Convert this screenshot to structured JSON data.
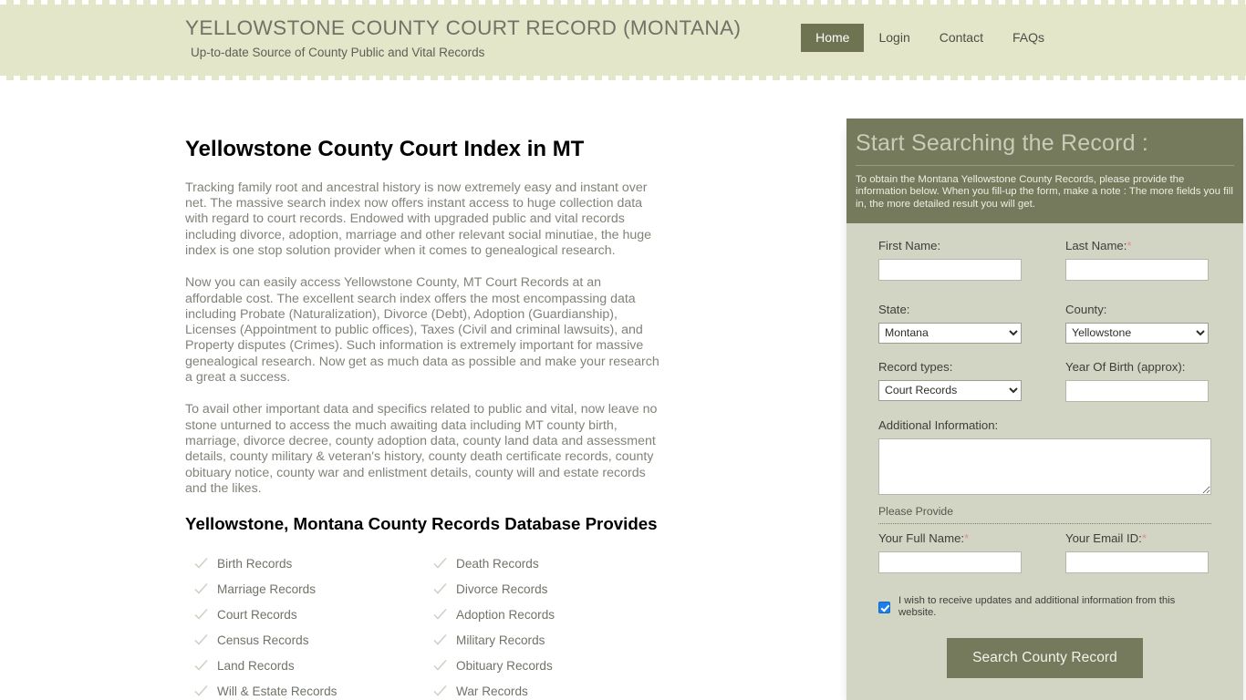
{
  "header": {
    "title": "YELLOWSTONE COUNTY COURT RECORD (MONTANA)",
    "tagline": "Up-to-date Source of  County Public and Vital Records",
    "nav": [
      {
        "label": "Home",
        "active": true
      },
      {
        "label": "Login",
        "active": false
      },
      {
        "label": "Contact",
        "active": false
      },
      {
        "label": "FAQs",
        "active": false
      }
    ]
  },
  "content": {
    "page_title": "Yellowstone County Court Index in MT",
    "paragraphs": [
      "Tracking family root and ancestral history is now extremely easy and instant over net. The massive search index now offers instant access to huge collection data with regard to court records. Endowed with upgraded public and vital records including divorce, adoption, marriage and other relevant social minutiae, the huge index is one stop solution provider when it comes to genealogical research.",
      "Now you can easily access Yellowstone County, MT Court Records at an affordable cost. The excellent search index offers the most encompassing data including Probate (Naturalization), Divorce (Debt), Adoption (Guardianship), Licenses (Appointment to public offices), Taxes (Civil and criminal lawsuits), and Property disputes (Crimes). Such information is extremely important for massive genealogical research. Now get as much data as possible and make your research a great a success.",
      "To avail other important data and specifics related to public and vital, now leave no stone unturned to access the much awaiting data including MT county birth, marriage, divorce decree, county adoption data, county land data and assessment details, county military & veteran's history, county death certificate records, county obituary notice, county war and enlistment details, county will and estate records and the likes."
    ],
    "section_title": "Yellowstone, Montana County Records Database Provides",
    "records": [
      "Birth Records",
      "Death Records",
      "Marriage Records",
      "Divorce Records",
      "Court Records",
      "Adoption Records",
      "Census Records",
      "Military Records",
      "Land Records",
      "Obituary Records",
      "Will & Estate Records",
      "War Records"
    ]
  },
  "search_form": {
    "heading": "Start Searching the Record :",
    "description": "To obtain the Montana Yellowstone County Records, please provide the information below. When you fill-up the form, make a note : The more fields you fill in, the more detailed result you will get.",
    "first_name_label": "First Name:",
    "first_name_value": "",
    "last_name_label": "Last Name:",
    "last_name_value": "",
    "state_label": "State:",
    "state_value": "Montana",
    "state_options": [
      "Montana"
    ],
    "county_label": "County:",
    "county_value": "Yellowstone",
    "county_options": [
      "Yellowstone"
    ],
    "record_types_label": "Record types:",
    "record_types_value": "Court Records",
    "record_types_options": [
      "Court Records"
    ],
    "year_of_birth_label": "Year Of Birth (approx):",
    "year_of_birth_value": "",
    "additional_info_label": "Additional Information:",
    "additional_info_value": "",
    "please_provide": "Please Provide",
    "full_name_label": "Your Full Name:",
    "full_name_value": "",
    "email_label": "Your Email ID:",
    "email_value": "",
    "required_marker": "*",
    "consent_label": "I wish to receive updates and additional information from this website.",
    "consent_checked": true,
    "submit_label": "Search County Record"
  },
  "colors": {
    "header_bg": "#e4e6c9",
    "panel_head_bg": "#767a5c",
    "panel_bg": "#d2d4c4",
    "accent_button": "#767a5c",
    "required_star": "#e08c8c",
    "checkbox_blue": "#1f7fe8"
  }
}
